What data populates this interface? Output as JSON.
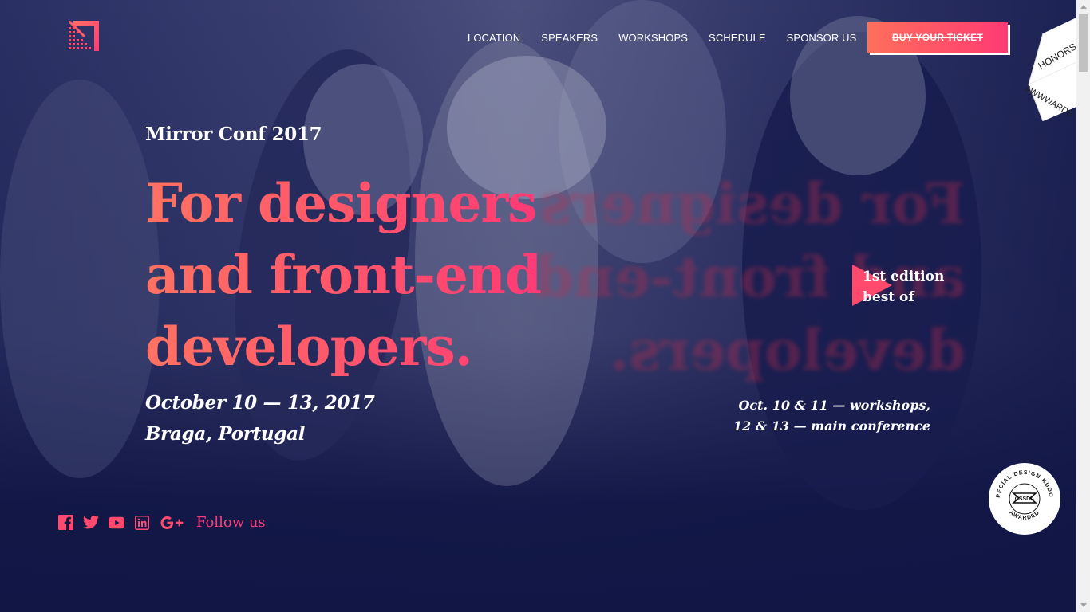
{
  "brand": {
    "logo_icon": "conference-logo-icon",
    "accent": "#ff4a6e",
    "background": "#111645"
  },
  "nav": {
    "items": [
      "LOCATION",
      "SPEAKERS",
      "WORKSHOPS",
      "SCHEDULE",
      "SPONSOR US"
    ],
    "cta_label": "BUY YOUR TICKET"
  },
  "hero": {
    "eyebrow": "Mirror Conf 2017",
    "headline": [
      "For designers",
      "and front-end",
      "developers."
    ],
    "dates": "October 10 — 13, 2017",
    "location": "Braga, Portugal",
    "edition": [
      "1st edition",
      "best of"
    ],
    "schedule": [
      "Oct. 10 & 11 — workshops,",
      "12 & 13 — main conference"
    ]
  },
  "social": {
    "icons": [
      "facebook-icon",
      "twitter-icon",
      "youtube-icon",
      "linkedin-icon",
      "google-plus-icon"
    ],
    "follow_label": "Follow us"
  },
  "badges": {
    "awwwards_top": "HONORS",
    "awwwards_bottom": "AWWWARDS",
    "cssda_ring_top": "SPECIAL DESIGN KUDOS",
    "cssda_ring_bottom": "AWARDED",
    "cssda_center": "CSSDA"
  }
}
